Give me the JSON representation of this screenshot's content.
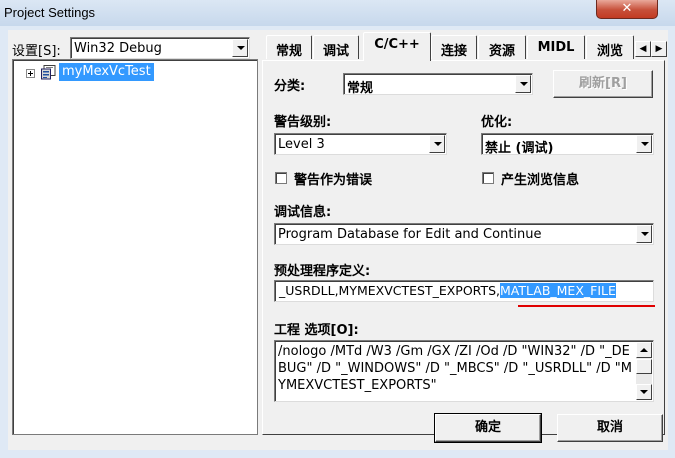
{
  "window": {
    "title": "Project Settings",
    "close_glyph": "✕"
  },
  "left": {
    "settings_label": "设置[S]:",
    "config_value": "Win32 Debug",
    "tree_item": "myMexVcTest",
    "tree_icon": "project-icon"
  },
  "tabs": {
    "items": [
      "常规",
      "调试",
      "C/C++",
      "连接",
      "资源",
      "MIDL",
      "浏览"
    ],
    "active": "C/C++"
  },
  "cc": {
    "category_label": "分类:",
    "category_value": "常规",
    "reset_button": "刷新[R]",
    "warning_label": "警告级别:",
    "warning_value": "Level 3",
    "optimize_label": "优化:",
    "optimize_value": "禁止 (调试)",
    "warn_as_error_label": "警告作为错误",
    "browse_info_label": "产生浏览信息",
    "debug_info_label": "调试信息:",
    "debug_info_value": "Program Database for Edit and Continue",
    "preproc_label": "预处理程序定义:",
    "preproc_value_plain": "_USRDLL,MYMEXVCTEST_EXPORTS,",
    "preproc_value_selected": "MATLAB_MEX_FILE",
    "project_options_label": "工程 选项[O]:",
    "project_options_text": "/nologo /MTd /W3 /Gm /GX /ZI /Od /D \"WIN32\" /D \"_DEBUG\" /D \"_WINDOWS\" /D \"_MBCS\" /D \"_USRDLL\" /D \"MYMEXVCTEST_EXPORTS\""
  },
  "footer": {
    "ok_button": "确定",
    "cancel_button": "取消"
  },
  "colors": {
    "annotation_red": "#e00000",
    "selection_blue": "#3399ff"
  }
}
